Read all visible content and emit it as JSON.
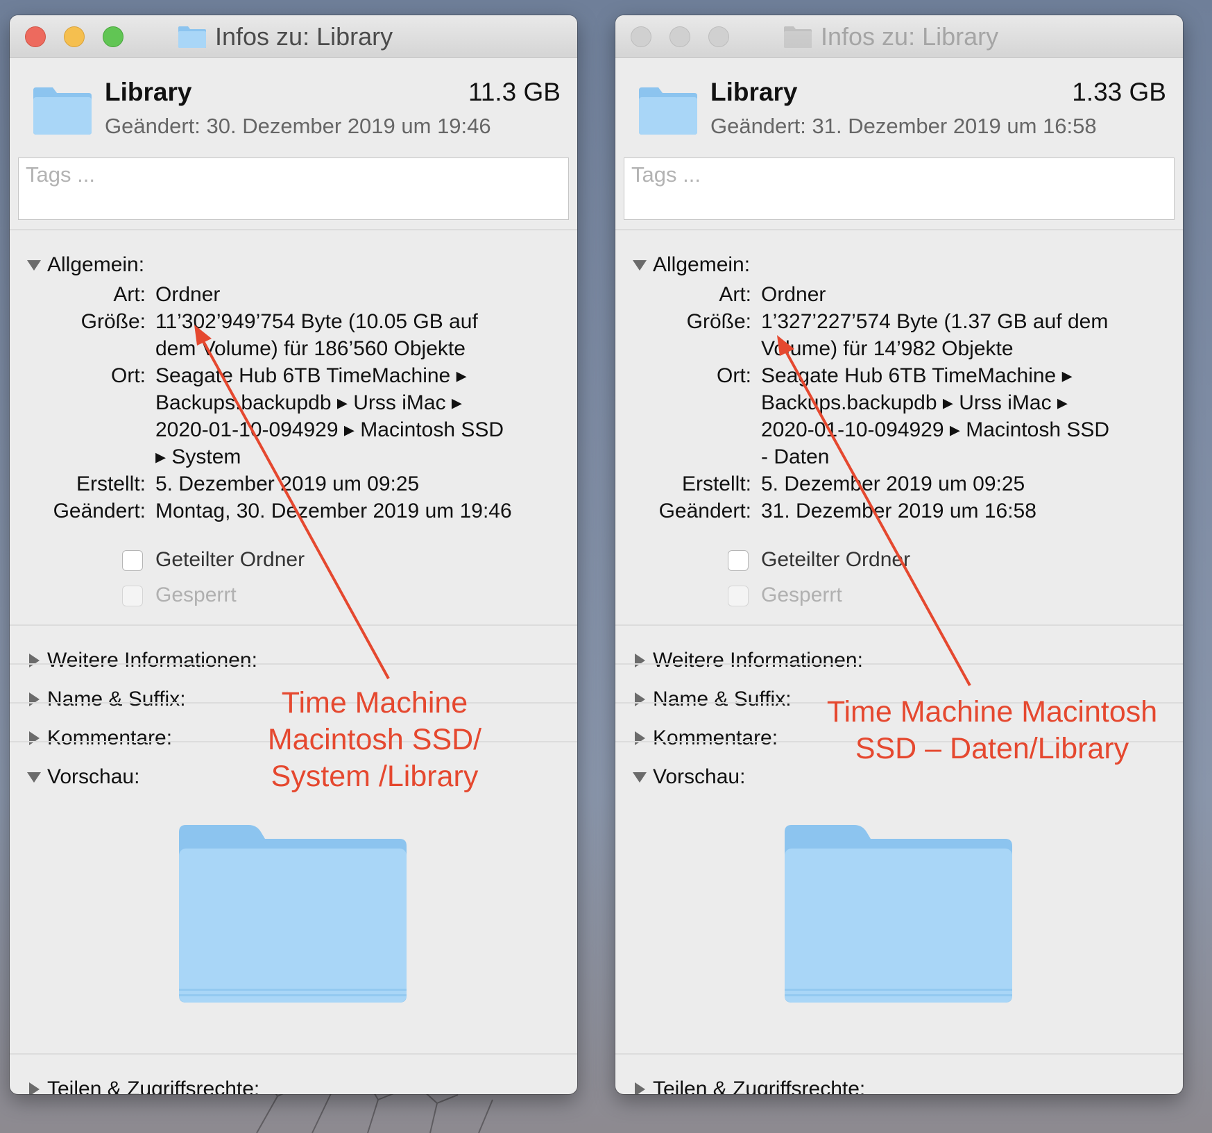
{
  "windows": [
    {
      "state": "active",
      "title": "Infos zu: Library",
      "name": "Library",
      "size_summary": "11.3 GB",
      "modified_head_label": "Geändert:",
      "modified_head_value": "30. Dezember 2019 um 19:46",
      "tags_placeholder": "Tags ...",
      "general_header": "Allgemein:",
      "art_label": "Art:",
      "art_value": "Ordner",
      "size_label": "Größe:",
      "size_line1": "11’302’949’754 Byte (10.05 GB auf",
      "size_line2": "dem Volume) für 186’560 Objekte",
      "location_label": "Ort:",
      "location_line1": "Seagate Hub 6TB TimeMachine ▸",
      "location_line2": "Backups.backupdb ▸ Urss iMac ▸",
      "location_line3": "2020-01-10-094929 ▸ Macintosh SSD",
      "location_line4": "▸ System",
      "created_label": "Erstellt:",
      "created_value": "5. Dezember 2019 um 09:25",
      "modified_label": "Geändert:",
      "modified_value": "Montag, 30. Dezember 2019 um 19:46",
      "shared_folder_label": "Geteilter Ordner",
      "locked_label": "Gesperrt",
      "more_info_header": "Weitere Informationen:",
      "name_suffix_header": "Name & Suffix:",
      "comments_header": "Kommentare:",
      "preview_header": "Vorschau:",
      "sharing_header": "Teilen & Zugriffsrechte:"
    },
    {
      "state": "inactive",
      "title": "Infos zu: Library",
      "name": "Library",
      "size_summary": "1.33 GB",
      "modified_head_label": "Geändert:",
      "modified_head_value": "31. Dezember 2019 um 16:58",
      "tags_placeholder": "Tags ...",
      "general_header": "Allgemein:",
      "art_label": "Art:",
      "art_value": "Ordner",
      "size_label": "Größe:",
      "size_line1": "1’327’227’574 Byte (1.37 GB auf dem",
      "size_line2": "Volume) für 14’982 Objekte",
      "location_label": "Ort:",
      "location_line1": "Seagate Hub 6TB TimeMachine ▸",
      "location_line2": "Backups.backupdb ▸ Urss iMac ▸",
      "location_line3": "2020-01-10-094929 ▸ Macintosh SSD",
      "location_line4": "- Daten",
      "created_label": "Erstellt:",
      "created_value": "5. Dezember 2019 um 09:25",
      "modified_label": "Geändert:",
      "modified_value": "31. Dezember 2019 um 16:58",
      "shared_folder_label": "Geteilter Ordner",
      "locked_label": "Gesperrt",
      "more_info_header": "Weitere Informationen:",
      "name_suffix_header": "Name & Suffix:",
      "comments_header": "Kommentare:",
      "preview_header": "Vorschau:",
      "sharing_header": "Teilen & Zugriffsrechte:"
    }
  ],
  "annotations": {
    "left": [
      "Time Machine",
      "Macintosh SSD/",
      "System /Library"
    ],
    "right": [
      "Time Machine Macintosh",
      "SSD – Daten/Library"
    ],
    "color": "#e5482f"
  },
  "colors": {
    "folder_light": "#a9d6f7",
    "folder_dark": "#8cc4ef",
    "close": "#ed6a5e",
    "minimize": "#f5bf4f",
    "zoom": "#61c554"
  }
}
